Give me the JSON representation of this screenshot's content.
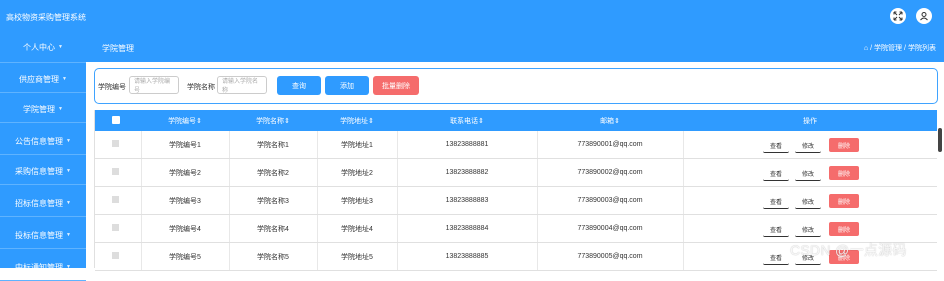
{
  "app": {
    "title": "高校物资采购管理系统"
  },
  "topbar": {
    "expand_icon": "expand-icon",
    "user_icon": "user-icon"
  },
  "sidebar": {
    "items": [
      {
        "label": "个人中心"
      },
      {
        "label": "供应商管理"
      },
      {
        "label": "学院管理"
      },
      {
        "label": "公告信息管理"
      },
      {
        "label": "采购信息管理"
      },
      {
        "label": "招标信息管理"
      },
      {
        "label": "投标信息管理"
      },
      {
        "label": "中标通知管理"
      }
    ]
  },
  "header": {
    "page_title": "学院管理",
    "breadcrumb": [
      "学院管理",
      "学院列表"
    ],
    "home_icon": "home-icon"
  },
  "search": {
    "code_label": "学院编号",
    "code_placeholder": "请输入学院编号",
    "name_label": "学院名称",
    "name_placeholder": "请输入学院名称",
    "query_button": "查询",
    "add_button": "添加",
    "batch_delete_button": "批量删除"
  },
  "table": {
    "columns": [
      "学院编号",
      "学院名称",
      "学院地址",
      "联系电话",
      "邮箱",
      "操作"
    ],
    "rows": [
      {
        "code": "学院编号1",
        "name": "学院名称1",
        "address": "学院地址1",
        "phone": "13823888881",
        "email": "773890001@qq.com"
      },
      {
        "code": "学院编号2",
        "name": "学院名称2",
        "address": "学院地址2",
        "phone": "13823888882",
        "email": "773890002@qq.com"
      },
      {
        "code": "学院编号3",
        "name": "学院名称3",
        "address": "学院地址3",
        "phone": "13823888883",
        "email": "773890003@qq.com"
      },
      {
        "code": "学院编号4",
        "name": "学院名称4",
        "address": "学院地址4",
        "phone": "13823888884",
        "email": "773890004@qq.com"
      },
      {
        "code": "学院编号5",
        "name": "学院名称5",
        "address": "学院地址5",
        "phone": "13823888885",
        "email": "773890005@qq.com"
      }
    ],
    "actions": {
      "view": "查看",
      "edit": "修改",
      "delete": "删除"
    }
  },
  "watermark": "CSDN @一点源码",
  "colors": {
    "primary": "#2f9bff",
    "danger": "#f56c6c"
  }
}
